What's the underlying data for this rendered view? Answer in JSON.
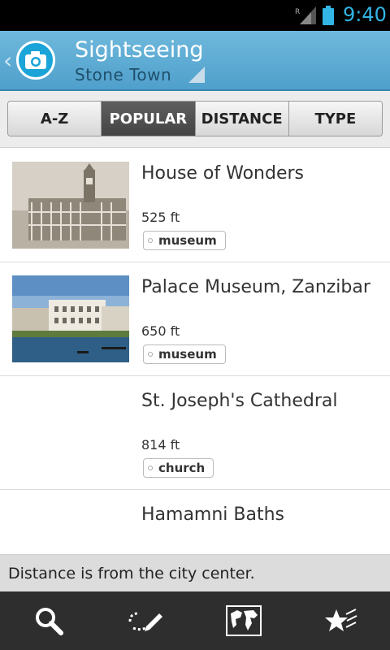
{
  "status_bar": {
    "time": "9:40",
    "roaming_indicator": "R",
    "clock_color": "#33b5e5"
  },
  "action_bar": {
    "title": "Sightseeing",
    "subtitle": "Stone Town",
    "app_icon": "camera-icon",
    "back_icon": "chevron-left-icon",
    "colors": {
      "bar": "#5aa9d3",
      "icon_bg": "#1aa4d8"
    }
  },
  "tabs": [
    {
      "label": "A-Z",
      "selected": false
    },
    {
      "label": "POPULAR",
      "selected": true
    },
    {
      "label": "DISTANCE",
      "selected": false
    },
    {
      "label": "TYPE",
      "selected": false
    }
  ],
  "places": [
    {
      "name": "House of Wonders",
      "distance": "525 ft",
      "tag": "museum",
      "has_photo": true
    },
    {
      "name": "Palace Museum, Zanzibar",
      "distance": "650 ft",
      "tag": "museum",
      "has_photo": true
    },
    {
      "name": "St. Joseph's Cathedral",
      "distance": "814 ft",
      "tag": "church",
      "has_photo": false
    },
    {
      "name": "Hamamni Baths",
      "distance": "",
      "tag": "",
      "has_photo": false
    }
  ],
  "info_bar": {
    "text": "Distance is from the city center."
  },
  "bottom_nav": [
    {
      "icon": "search-icon"
    },
    {
      "icon": "route-pencil-icon"
    },
    {
      "icon": "world-map-icon"
    },
    {
      "icon": "favorites-star-icon"
    }
  ]
}
